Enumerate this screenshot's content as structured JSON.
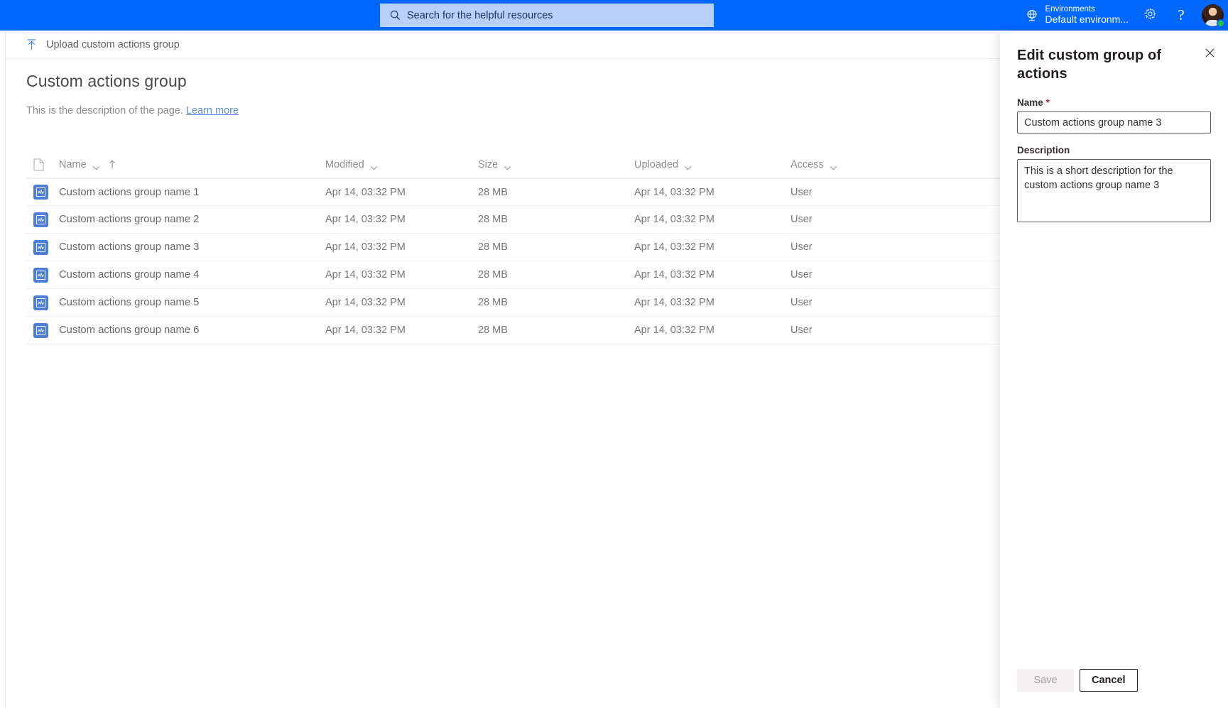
{
  "topbar": {
    "search": {
      "placeholder": "Search for the helpful resources",
      "icon": "search-icon"
    },
    "environment": {
      "label": "Environments",
      "value": "Default environm...",
      "icon": "environment-globe-icon"
    },
    "settings_icon": "gear-icon",
    "help_icon": "help-question-icon",
    "help_glyph": "?",
    "avatar": "user-avatar",
    "presence": "available-status",
    "background_color": "#0067FF",
    "search_background_color": "#B7D2FA"
  },
  "commandbar": {
    "upload": {
      "label": "Upload custom actions group",
      "icon": "upload-arrow-icon"
    }
  },
  "page": {
    "title": "Custom actions group",
    "description": "This is the description of the page.",
    "learn_more": "Learn more"
  },
  "table": {
    "columns": [
      {
        "key": "icon",
        "label": "",
        "icon": "file-document-icon",
        "sortable": false
      },
      {
        "key": "name",
        "label": "Name",
        "has_chevron": true,
        "sorted": "asc",
        "sort_icon": "sort-ascending-arrow-icon"
      },
      {
        "key": "modified",
        "label": "Modified",
        "has_chevron": true
      },
      {
        "key": "size",
        "label": "Size",
        "has_chevron": true
      },
      {
        "key": "uploaded",
        "label": "Uploaded",
        "has_chevron": true
      },
      {
        "key": "access",
        "label": "Access",
        "has_chevron": true
      }
    ],
    "rows": [
      {
        "icon": "custom-action-group-icon",
        "name": "Custom actions group name 1",
        "modified": "Apr 14, 03:32 PM",
        "size": "28 MB",
        "uploaded": "Apr 14, 03:32 PM",
        "access": "User"
      },
      {
        "icon": "custom-action-group-icon",
        "name": "Custom actions group name 2",
        "modified": "Apr 14, 03:32 PM",
        "size": "28 MB",
        "uploaded": "Apr 14, 03:32 PM",
        "access": "User"
      },
      {
        "icon": "custom-action-group-icon",
        "name": "Custom actions group name 3",
        "modified": "Apr 14, 03:32 PM",
        "size": "28 MB",
        "uploaded": "Apr 14, 03:32 PM",
        "access": "User"
      },
      {
        "icon": "custom-action-group-icon",
        "name": "Custom actions group name 4",
        "modified": "Apr 14, 03:32 PM",
        "size": "28 MB",
        "uploaded": "Apr 14, 03:32 PM",
        "access": "User"
      },
      {
        "icon": "custom-action-group-icon",
        "name": "Custom actions group name 5",
        "modified": "Apr 14, 03:32 PM",
        "size": "28 MB",
        "uploaded": "Apr 14, 03:32 PM",
        "access": "User"
      },
      {
        "icon": "custom-action-group-icon",
        "name": "Custom actions group name 6",
        "modified": "Apr 14, 03:32 PM",
        "size": "28 MB",
        "uploaded": "Apr 14, 03:32 PM",
        "access": "User"
      }
    ]
  },
  "panel": {
    "title": "Edit custom group of actions",
    "close_icon": "close-icon",
    "fields": {
      "name": {
        "label": "Name",
        "required_marker": "*",
        "value": "Custom actions group name 3"
      },
      "description": {
        "label": "Description",
        "value": "This is a short description for the custom actions group name 3"
      }
    },
    "buttons": {
      "save": "Save",
      "cancel": "Cancel"
    },
    "save_enabled": false
  },
  "colors": {
    "accent": "#0067FF",
    "item_icon": "#4D7DD4",
    "link": "#5b8fd6",
    "required": "#a4262c",
    "presence": "#27c23c"
  }
}
